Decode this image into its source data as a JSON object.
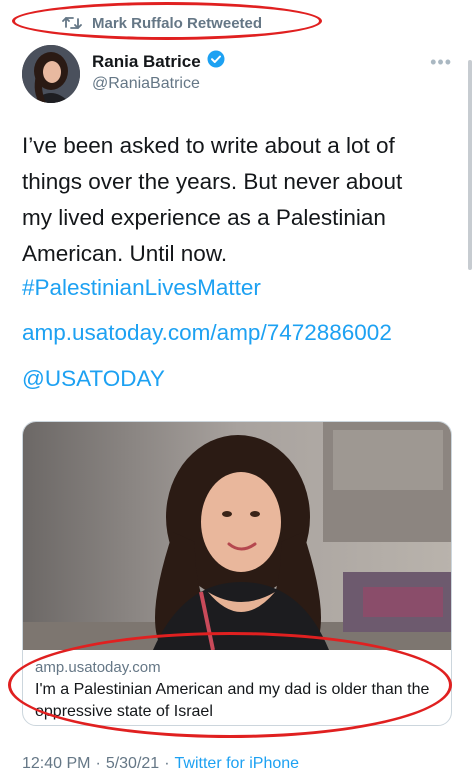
{
  "retweet": {
    "icon": "retweet-icon",
    "label": "Mark Ruffalo Retweeted"
  },
  "author": {
    "display_name": "Rania Batrice",
    "handle": "@RaniaBatrice",
    "verified_icon": "verified-badge-icon"
  },
  "tweet": {
    "text": "I’ve been asked to write about a lot of\nthings over the years. But never about\nmy lived experience as a Palestinian\nAmerican. Until now.",
    "hashtag": "#PalestinianLivesMatter",
    "url": "amp.usatoday.com/amp/7472886002",
    "mention": "@USATODAY"
  },
  "card": {
    "domain": "amp.usatoday.com",
    "title": "I'm a Palestinian American and my dad is older than the oppressive state of Israel"
  },
  "meta": {
    "time": "12:40 PM",
    "separator1": "·",
    "date": "5/30/21",
    "separator2": "·",
    "source": "Twitter for iPhone"
  },
  "colors": {
    "link": "#1da1f2",
    "secondary_text": "#657786",
    "annotation": "#e02020"
  }
}
